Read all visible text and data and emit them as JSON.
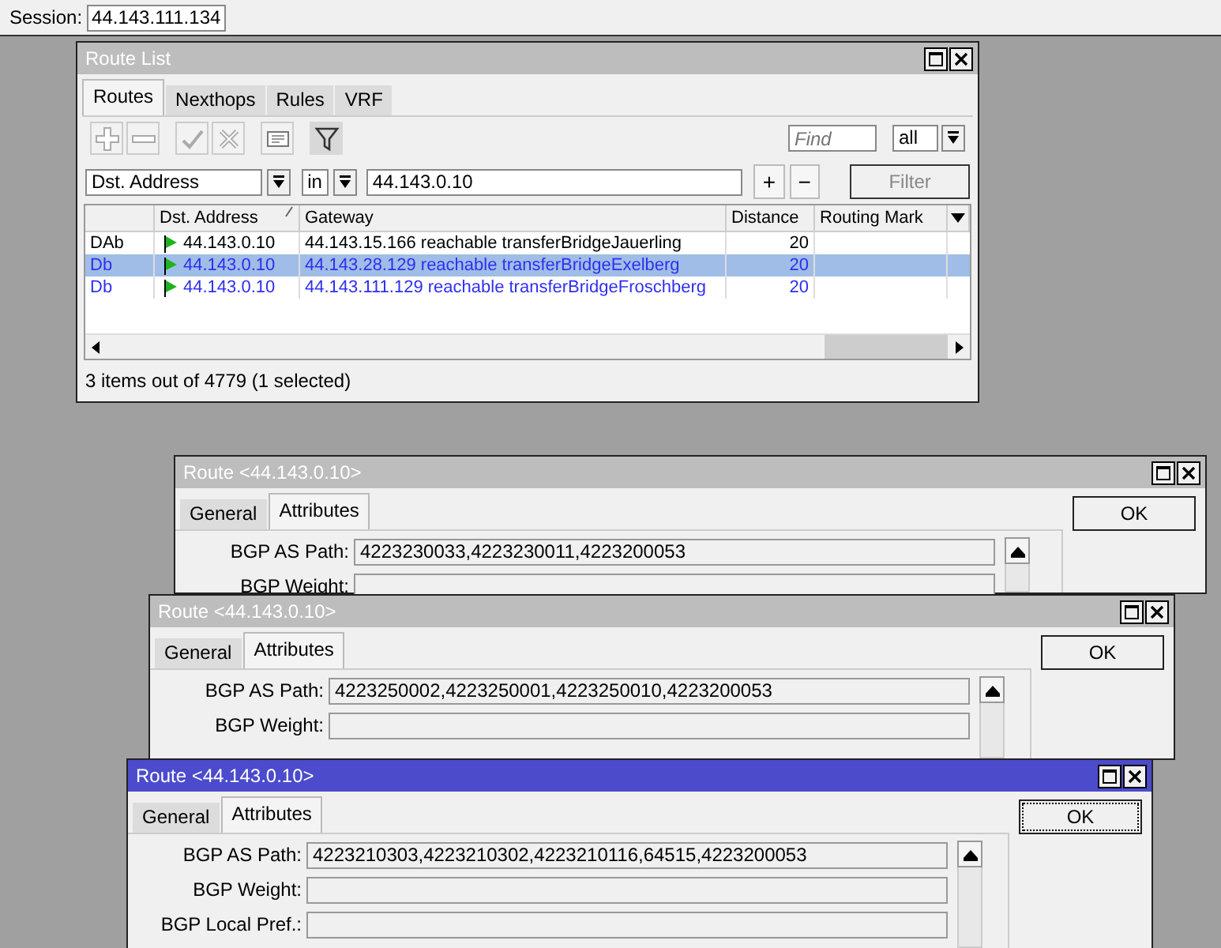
{
  "session": {
    "label": "Session:",
    "value": "44.143.111.134"
  },
  "route_list": {
    "title": "Route List",
    "active": false,
    "tabs": [
      {
        "label": "Routes",
        "selected": true
      },
      {
        "label": "Nexthops",
        "selected": false
      },
      {
        "label": "Rules",
        "selected": false
      },
      {
        "label": "VRF",
        "selected": false
      }
    ],
    "filter_active": true,
    "find": {
      "placeholder": "Find"
    },
    "scope": "all",
    "filter": {
      "field": "Dst. Address",
      "operator": "in",
      "value": "44.143.0.10",
      "add": "+",
      "remove": "−",
      "button": "Filter"
    },
    "columns": [
      "Dst. Address",
      "Gateway",
      "Distance",
      "Routing Mark"
    ],
    "rows": [
      {
        "flags": "DAb",
        "dst": "44.143.0.10",
        "gateway": "44.143.15.166 reachable transferBridgeJauerling",
        "distance": "20",
        "active": true,
        "selected": false
      },
      {
        "flags": "Db",
        "dst": "44.143.0.10",
        "gateway": "44.143.28.129 reachable transferBridgeExelberg",
        "distance": "20",
        "active": false,
        "selected": true
      },
      {
        "flags": "Db",
        "dst": "44.143.0.10",
        "gateway": "44.143.111.129 reachable transferBridgeFroschberg",
        "distance": "20",
        "active": false,
        "selected": false
      }
    ],
    "status": "3 items out of 4779 (1 selected)"
  },
  "route_windows": [
    {
      "title": "Route <44.143.0.10>",
      "active": false,
      "tabs": [
        {
          "label": "General",
          "selected": false
        },
        {
          "label": "Attributes",
          "selected": true
        }
      ],
      "fields": [
        {
          "label": "BGP AS Path:",
          "value": "4223230033,4223230011,4223200053"
        },
        {
          "label": "BGP Weight:"
        }
      ],
      "ok": "OK"
    },
    {
      "title": "Route <44.143.0.10>",
      "active": false,
      "tabs": [
        {
          "label": "General",
          "selected": false
        },
        {
          "label": "Attributes",
          "selected": true
        }
      ],
      "fields": [
        {
          "label": "BGP AS Path:",
          "value": "4223250002,4223250001,4223250010,4223200053"
        },
        {
          "label": "BGP Weight:"
        }
      ],
      "ok": "OK"
    },
    {
      "title": "Route <44.143.0.10>",
      "active": true,
      "tabs": [
        {
          "label": "General",
          "selected": false
        },
        {
          "label": "Attributes",
          "selected": true
        }
      ],
      "fields": [
        {
          "label": "BGP AS Path:",
          "value": "4223210303,4223210302,4223210116,64515,4223200053"
        },
        {
          "label": "BGP Weight:"
        },
        {
          "label": "BGP Local Pref.:"
        }
      ],
      "ok": "OK"
    }
  ]
}
